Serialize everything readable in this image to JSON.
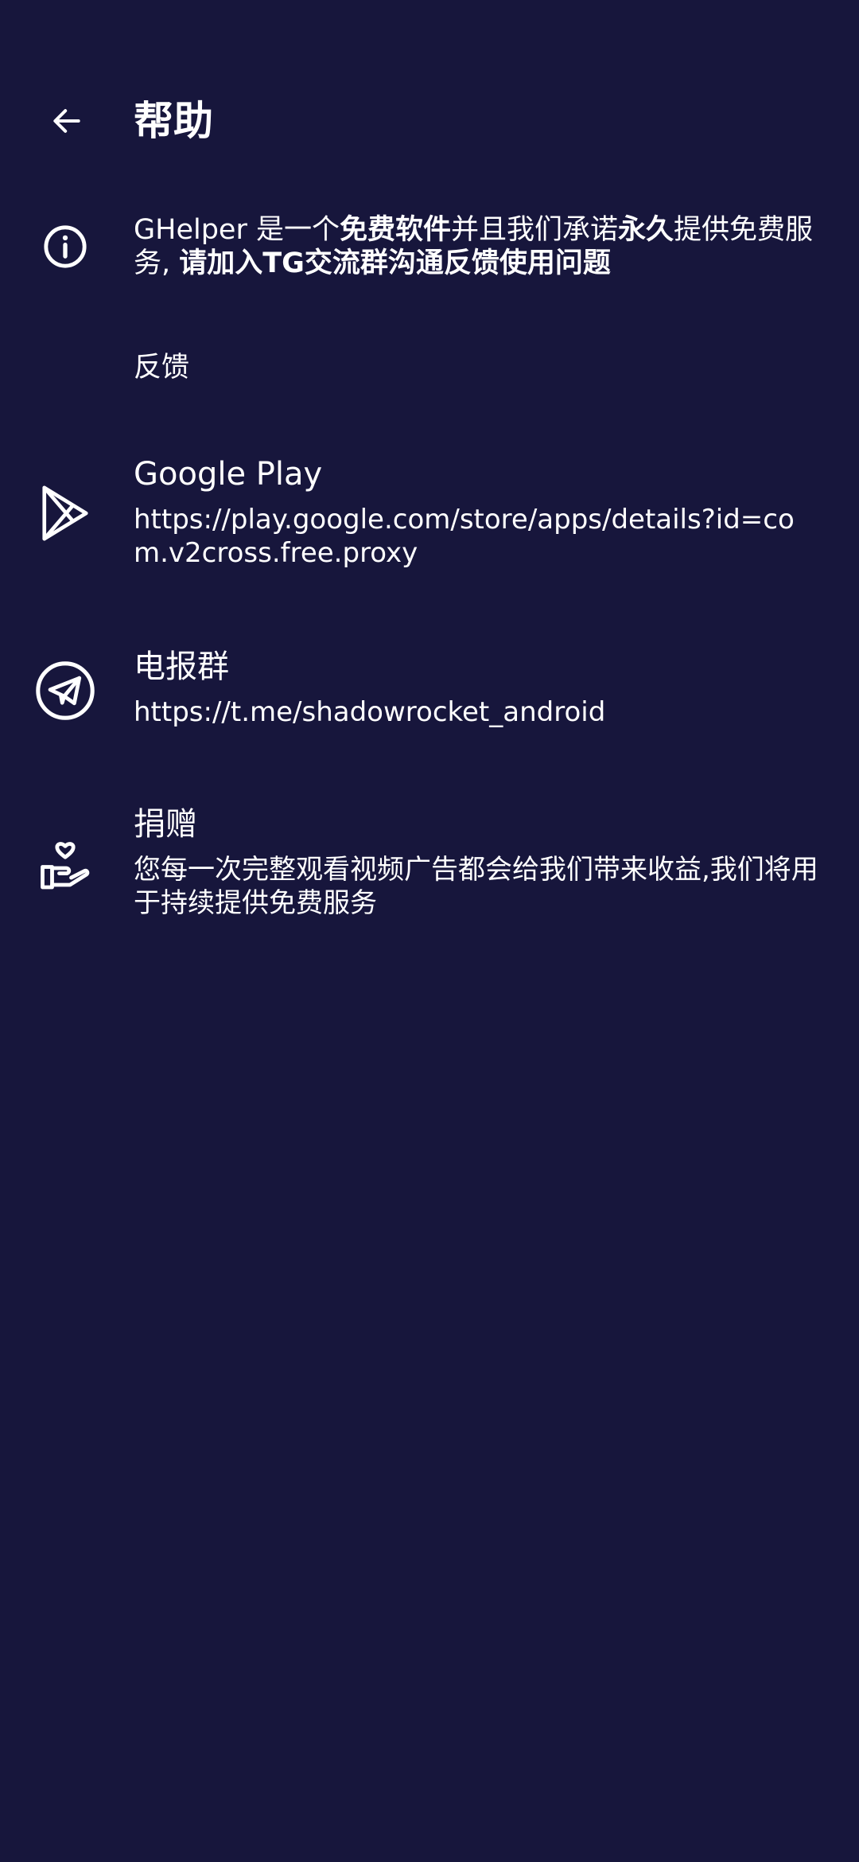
{
  "header": {
    "back_icon": "arrow-left-icon",
    "title": "帮助"
  },
  "notice": {
    "icon": "info-icon",
    "parts": [
      {
        "text": "GHelper 是一个",
        "bold": false
      },
      {
        "text": "免费软件",
        "bold": true
      },
      {
        "text": "并且我们承诺",
        "bold": false
      },
      {
        "text": "永久",
        "bold": true
      },
      {
        "text": "提供免费服务, ",
        "bold": false
      },
      {
        "text": "请加入TG交流群沟通反馈使用问题",
        "bold": true
      }
    ]
  },
  "feedback": {
    "section_label": "反馈",
    "items": [
      {
        "icon": "play-store-icon",
        "title": "Google Play",
        "subtitle": "https://play.google.com/store/apps/details?id=com.v2cross.free.proxy"
      },
      {
        "icon": "telegram-icon",
        "title": "电报群",
        "subtitle": "https://t.me/shadowrocket_android"
      },
      {
        "icon": "donate-hand-heart-icon",
        "title": "捐赠",
        "subtitle": "您每一次完整观看视频广告都会给我们带来收益,我们将用于持续提供免费服务"
      }
    ]
  },
  "colors": {
    "background": "#17163c",
    "text": "#ffffff"
  }
}
